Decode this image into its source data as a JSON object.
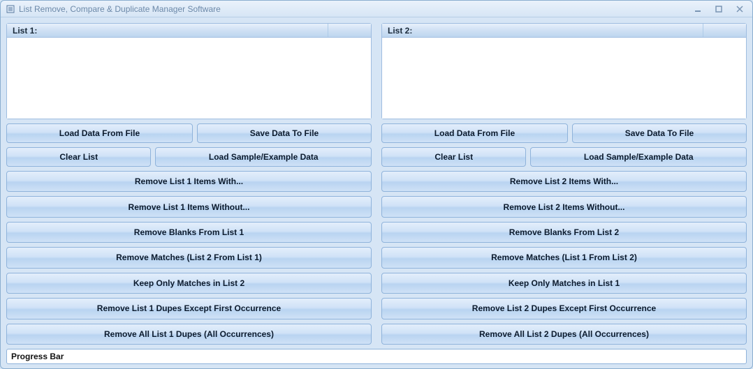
{
  "window": {
    "title": "List Remove, Compare & Duplicate Manager Software"
  },
  "list1": {
    "header": "List 1:"
  },
  "list2": {
    "header": "List 2:"
  },
  "buttons": {
    "left": {
      "load": "Load Data From File",
      "save": "Save Data To File",
      "clear": "Clear List",
      "sample": "Load Sample/Example Data",
      "remove_with": "Remove List 1 Items With...",
      "remove_without": "Remove List 1 Items Without...",
      "remove_blanks": "Remove Blanks From List 1",
      "remove_matches": "Remove Matches (List 2 From List 1)",
      "keep_matches": "Keep Only Matches in List 2",
      "dupes_except_first": "Remove List 1 Dupes Except First Occurrence",
      "dupes_all": "Remove All List 1 Dupes (All Occurrences)"
    },
    "right": {
      "load": "Load Data From File",
      "save": "Save Data To File",
      "clear": "Clear List",
      "sample": "Load Sample/Example Data",
      "remove_with": "Remove List 2 Items With...",
      "remove_without": "Remove List 2 Items Without...",
      "remove_blanks": "Remove Blanks From List 2",
      "remove_matches": "Remove Matches (List 1 From List 2)",
      "keep_matches": "Keep Only Matches in List 1",
      "dupes_except_first": "Remove List 2 Dupes Except First Occurrence",
      "dupes_all": "Remove All List 2 Dupes (All Occurrences)"
    }
  },
  "progress": {
    "label": "Progress Bar"
  }
}
